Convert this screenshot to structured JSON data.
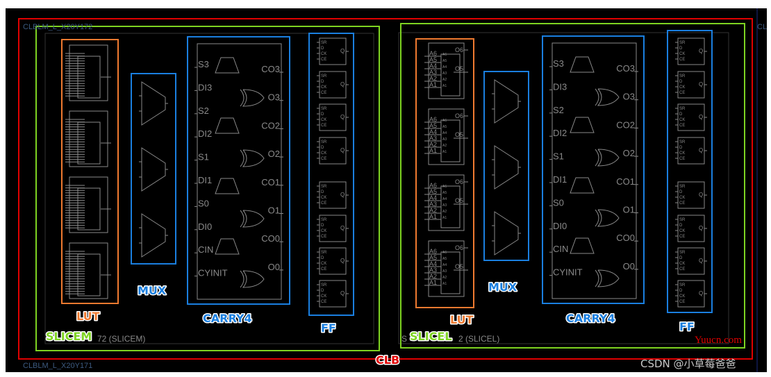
{
  "colors": {
    "clb": "#e00000",
    "slice": "#7ed321",
    "lut": "#f07a30",
    "block": "#1a7fe0",
    "wire": "#8a8a8a",
    "background": "#000000"
  },
  "tiles": {
    "top": "CLBLM_L_X20Y172",
    "bottom": "CLBLM_L_X20Y171",
    "right_partial": "CL"
  },
  "clb_label": "CLB",
  "slices": [
    {
      "type_label": "SLICEM",
      "name_suffix": "72 (SLICEM)",
      "lut_label": "LUT",
      "mux_label": "MUX",
      "carry_label": "CARRY4",
      "ff_label": "FF"
    },
    {
      "type_label": "SLICEL",
      "name_prefix": "S",
      "name_suffix": "2 (SLICEL)",
      "lut_label": "LUT",
      "mux_label": "MUX",
      "carry_label": "CARRY4",
      "ff_label": "FF"
    }
  ],
  "lut_pins": {
    "inputs": [
      "A6",
      "A5",
      "A4",
      "A3",
      "A2",
      "A1"
    ],
    "outputs": [
      "O6",
      "O5"
    ]
  },
  "carry_pins": {
    "left": [
      "S3",
      "DI3",
      "S2",
      "DI2",
      "S1",
      "DI1",
      "S0",
      "DI0",
      "CIN",
      "CYINIT"
    ],
    "right": [
      "CO3",
      "O3",
      "CO2",
      "O2",
      "CO1",
      "O1",
      "CO0",
      "O0"
    ]
  },
  "ff_pins": {
    "inputs": [
      "SR",
      "D",
      "CK",
      "CE"
    ],
    "output": "Q"
  },
  "watermarks": {
    "site": "Yuucn.com",
    "author": "CSDN @小草莓爸爸"
  }
}
